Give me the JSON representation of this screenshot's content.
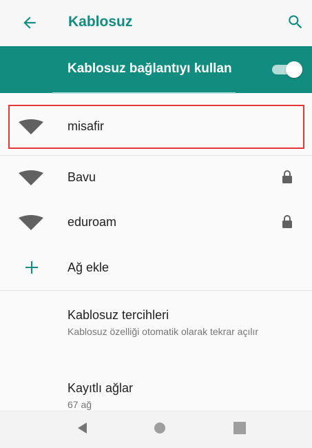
{
  "header": {
    "title": "Kablosuz"
  },
  "toggle": {
    "label": "Kablosuz bağlantıyı kullan",
    "enabled": true
  },
  "colors": {
    "accent": "#128c7e",
    "highlight": "#e53935"
  },
  "networks": [
    {
      "name": "misafir",
      "locked": false
    },
    {
      "name": "Bavu",
      "locked": true
    },
    {
      "name": "eduroam",
      "locked": true
    }
  ],
  "add_network": {
    "label": "Ağ ekle"
  },
  "preferences": {
    "title": "Kablosuz tercihleri",
    "subtitle": "Kablosuz özelliği otomatik olarak tekrar açılır"
  },
  "saved_networks": {
    "title": "Kayıtlı ağlar",
    "subtitle": "67 ağ"
  },
  "icons": {
    "back": "arrow-left-icon",
    "search": "search-icon",
    "wifi": "wifi-icon",
    "lock": "lock-icon",
    "add": "plus-icon",
    "nav_back": "triangle-back-icon",
    "nav_home": "circle-home-icon",
    "nav_recents": "square-recents-icon"
  }
}
